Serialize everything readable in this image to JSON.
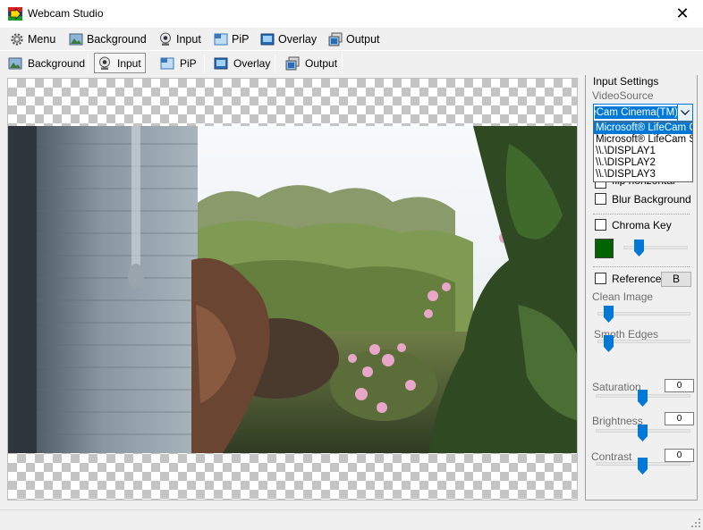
{
  "window": {
    "title": "Webcam Studio",
    "close_glyph": "✕"
  },
  "menu": {
    "items": [
      {
        "label": "Menu",
        "icon": "gear-icon"
      },
      {
        "label": "Background",
        "icon": "background-image-icon"
      },
      {
        "label": "Input",
        "icon": "webcam-icon"
      },
      {
        "label": "PiP",
        "icon": "pip-icon"
      },
      {
        "label": "Overlay",
        "icon": "overlay-icon"
      },
      {
        "label": "Output",
        "icon": "output-icon"
      }
    ]
  },
  "toolbar": {
    "items": [
      {
        "label": "Background",
        "icon": "background-image-icon",
        "active": false
      },
      {
        "label": "Input",
        "icon": "webcam-icon",
        "active": true
      },
      {
        "label": "PiP",
        "icon": "pip-icon",
        "active": false
      },
      {
        "label": "Overlay",
        "icon": "overlay-icon",
        "active": false
      },
      {
        "label": "Output",
        "icon": "output-icon",
        "active": false
      }
    ]
  },
  "panel": {
    "title": "Input Settings",
    "video_source_label": "VideoSource",
    "video_source_value": "eCam Cinema(TM)",
    "video_source_options": [
      "Microsoft® LifeCam Cin",
      "Microsoft® LifeCam Stu",
      "\\\\.\\DISPLAY1",
      "\\\\.\\DISPLAY2",
      "\\\\.\\DISPLAY3"
    ],
    "flip_label": "flip horizontal",
    "blur_label": "Blur Background",
    "chroma_label": "Chroma Key",
    "chroma_color": "#006400",
    "chroma_level": 0.2,
    "reference_label": "Reference",
    "reference_button": "B",
    "clean_image_label": "Clean Image",
    "clean_image_level": 0.07,
    "smooth_edges_label": "Smoth Edges",
    "smooth_edges_level": 0.07,
    "saturation_label": "Saturation",
    "saturation_value": "0",
    "brightness_label": "Brightness",
    "brightness_value": "0",
    "contrast_label": "Contrast",
    "contrast_value": "0",
    "accent_color": "#0078d7"
  }
}
